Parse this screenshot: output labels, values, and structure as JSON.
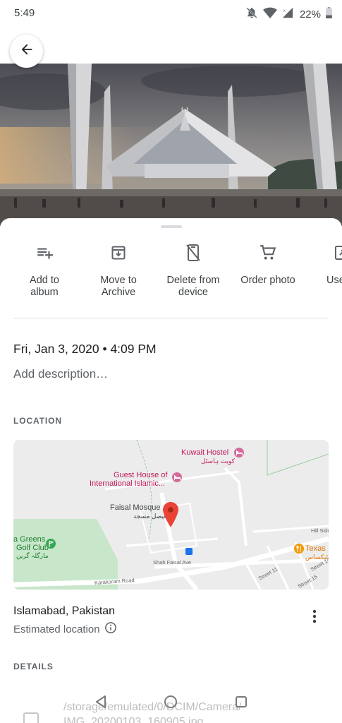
{
  "status_bar": {
    "time": "5:49",
    "battery": "22%",
    "icons": [
      "do-not-disturb-icon",
      "wifi-icon",
      "signal-icon",
      "battery-icon"
    ]
  },
  "photo": {
    "subject": "mosque-photo"
  },
  "actions": [
    {
      "label": "Add to\nalbum",
      "icon": "playlist-add-icon"
    },
    {
      "label": "Move to\nArchive",
      "icon": "archive-icon"
    },
    {
      "label": "Delete from\ndevice",
      "icon": "phone-delete-icon"
    },
    {
      "label": "Order photo",
      "icon": "cart-icon"
    },
    {
      "label": "Use",
      "icon": "open-icon"
    }
  ],
  "info": {
    "datetime": "Fri, Jan 3, 2020  •  4:09 PM",
    "description_placeholder": "Add description…"
  },
  "location": {
    "section_label": "LOCATION",
    "place_name": "Islamabad, Pakistan",
    "place_sub": "Estimated location",
    "map_labels": {
      "kuwait_hostel": "Kuwait Hostel",
      "kuwait_hostel_ur": "کویت ہاسٹل",
      "guest_house_1": "Guest House of",
      "guest_house_2": "International Islamic...",
      "faisal_mosque": "Faisal Mosque",
      "faisal_mosque_ur": "فیصل مسجد",
      "greens_1": "a Greens",
      "greens_2": "Golf Club",
      "greens_ur": "مارگلہ گرین",
      "texas": "Texas",
      "texas_ur": "ٹیکساس",
      "hill_side": "Hill Side",
      "shah_faisal": "Shah Faisal Ave",
      "karakoram": "Karakoram Road",
      "street_11": "Street 11",
      "street_14": "Street 14",
      "street_15": "Street 15"
    }
  },
  "details": {
    "section_label": "DETAILS",
    "path_line1": "/storage/emulated/0/DCIM/Camera/",
    "path_line2": "IMG_20200103_160905.jpg"
  },
  "colors": {
    "accent": "#1a73e8",
    "map_pin": "#ea4335",
    "map_park": "#c8e6c9"
  }
}
